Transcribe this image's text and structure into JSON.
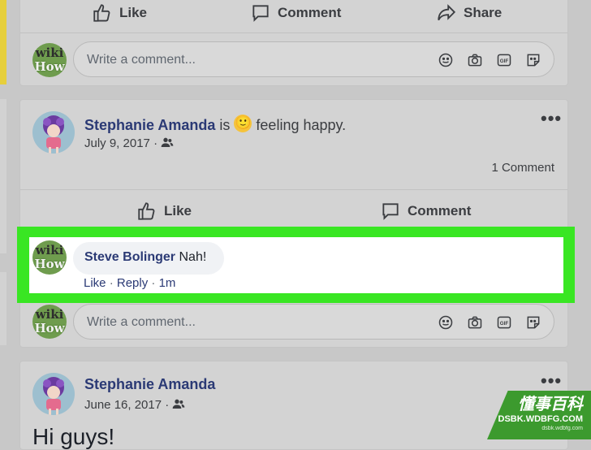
{
  "top_card": {
    "actions": {
      "like": "Like",
      "comment": "Comment",
      "share": "Share"
    },
    "comment_placeholder": "Write a comment..."
  },
  "post1": {
    "author": "Stephanie Amanda",
    "status_prefix": "is",
    "emoji": "🙂",
    "feeling": "feeling happy.",
    "date": "July 9, 2017",
    "separator": "·",
    "comment_count": "1 Comment",
    "actions": {
      "like": "Like",
      "comment": "Comment"
    },
    "comment": {
      "author": "Steve Bolinger",
      "text": "Nah!",
      "like": "Like",
      "reply": "Reply",
      "time": "1m"
    },
    "comment_placeholder": "Write a comment..."
  },
  "post2": {
    "author": "Stephanie Amanda",
    "date": "June 16, 2017",
    "separator": "·",
    "text": "Hi guys!"
  },
  "avatar_wiki": {
    "top": "wiki",
    "bottom": "How"
  },
  "watermark": {
    "cn": "懂事百科",
    "url": "DSBK.WDBFG.COM",
    "small": "dsbk.wdbfg.com"
  }
}
